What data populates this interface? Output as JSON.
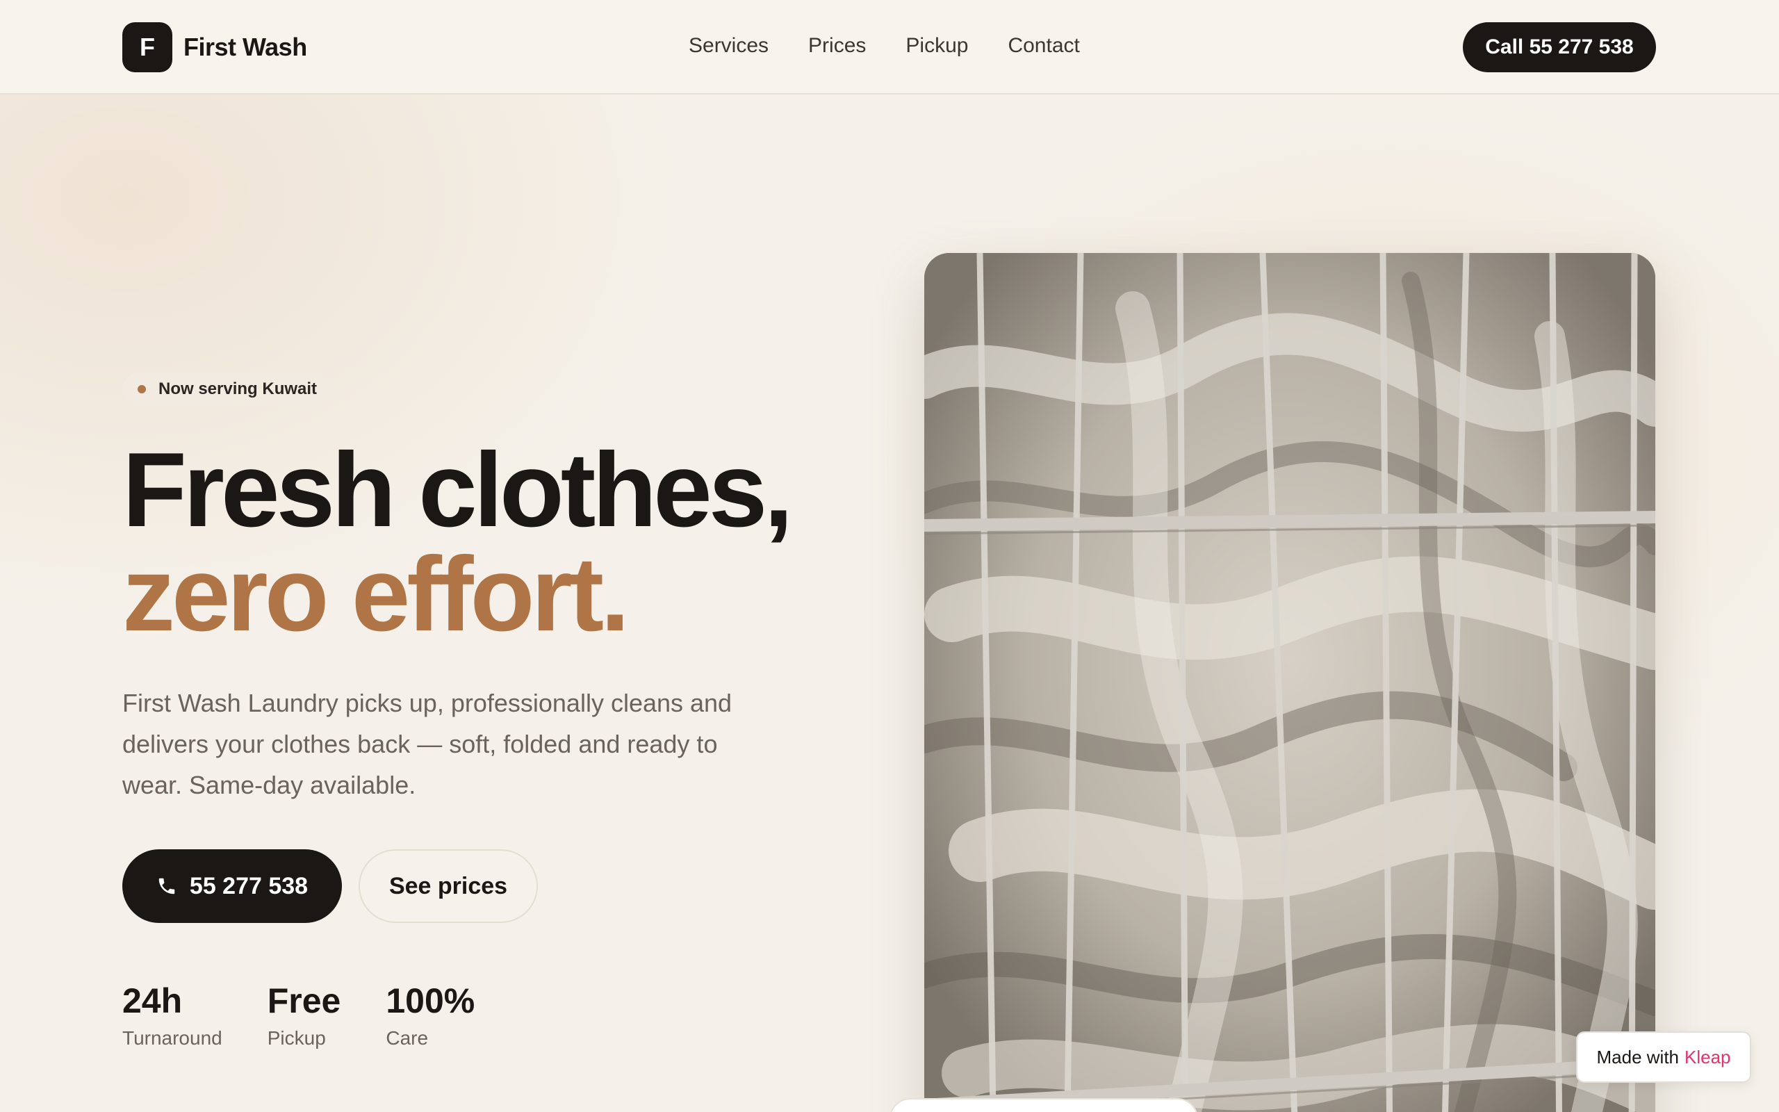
{
  "header": {
    "logo_letter": "F",
    "brand": "First Wash",
    "nav": [
      {
        "label": "Services"
      },
      {
        "label": "Prices"
      },
      {
        "label": "Pickup"
      },
      {
        "label": "Contact"
      }
    ],
    "call_label": "Call 55 277 538"
  },
  "hero": {
    "badge": "Now serving Kuwait",
    "headline_line1": "Fresh clothes,",
    "headline_line2": "zero effort.",
    "lead": "First Wash Laundry picks up, professionally cleans and delivers your clothes back — soft, folded and ready to wear. Same-day available.",
    "phone_button": "55 277 538",
    "prices_button": "See prices",
    "stats": [
      {
        "value": "24h",
        "label": "Turnaround"
      },
      {
        "value": "Free",
        "label": "Pickup"
      },
      {
        "value": "100%",
        "label": "Care"
      }
    ]
  },
  "footer_badge": {
    "prefix": "Made with",
    "brand": "Kleap"
  },
  "colors": {
    "accent": "#b07547",
    "dark": "#1a1715",
    "background": "#f6f2ea",
    "kleap_brand": "#e2336b"
  },
  "icons": {
    "phone": "phone-icon"
  }
}
